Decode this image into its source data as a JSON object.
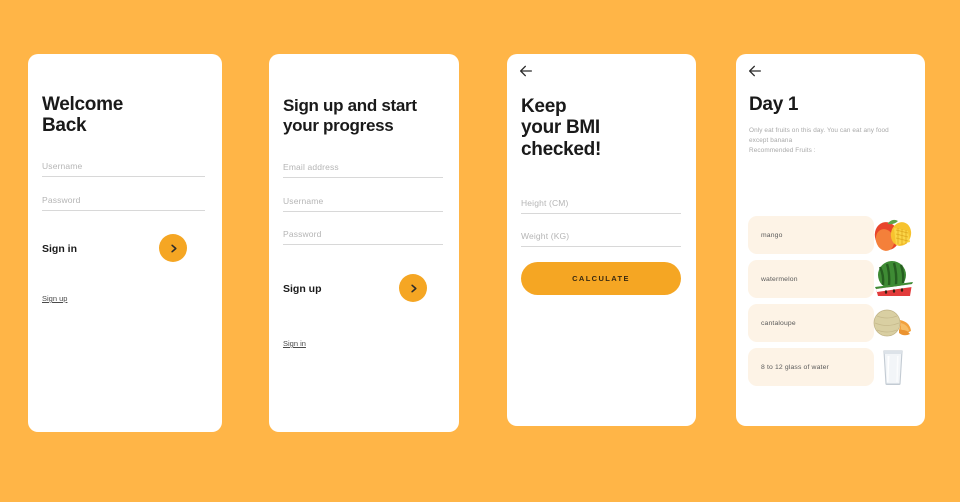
{
  "theme": {
    "background_color": "#FFB547",
    "card_color": "#FFFFFF",
    "accent_color": "#F5A623",
    "pill_color": "#FDF3E6",
    "placeholder_color": "#B5B5B5",
    "heading_color": "#1A1A1A"
  },
  "screens": [
    {
      "id": "welcome",
      "title_line1": "Welcome",
      "title_line2": "Back",
      "fields": [
        {
          "placeholder": "Username"
        },
        {
          "placeholder": "Password"
        }
      ],
      "action_label": "Sign in",
      "arrow_icon": "chevron-right-icon",
      "alt_link": "Sign up"
    },
    {
      "id": "signup",
      "title_line1": "Sign up and start",
      "title_line2": "your progress",
      "fields": [
        {
          "placeholder": "Email address"
        },
        {
          "placeholder": "Username"
        },
        {
          "placeholder": "Password"
        }
      ],
      "action_label": "Sign up",
      "arrow_icon": "chevron-right-icon",
      "alt_link": "Sign in"
    },
    {
      "id": "bmi",
      "back_icon": "arrow-left-icon",
      "title_line1": "Keep",
      "title_line2": "your BMI",
      "title_line3": "checked!",
      "fields": [
        {
          "placeholder": "Height (CM)"
        },
        {
          "placeholder": "Weight (KG)"
        }
      ],
      "submit_label": "CALCULATE"
    },
    {
      "id": "day1",
      "back_icon": "arrow-left-icon",
      "title": "Day 1",
      "description_line1": "Only eat fruits on this day. You can eat any food",
      "description_line2": "except banana",
      "description_line3": "Recommended Fruits :",
      "items": [
        {
          "label": "mango",
          "image": "mango-image"
        },
        {
          "label": "watermelon",
          "image": "watermelon-image"
        },
        {
          "label": "cantaloupe",
          "image": "cantaloupe-image"
        },
        {
          "label": "8 to 12 glass of water",
          "image": "water-glass-image"
        }
      ]
    }
  ]
}
